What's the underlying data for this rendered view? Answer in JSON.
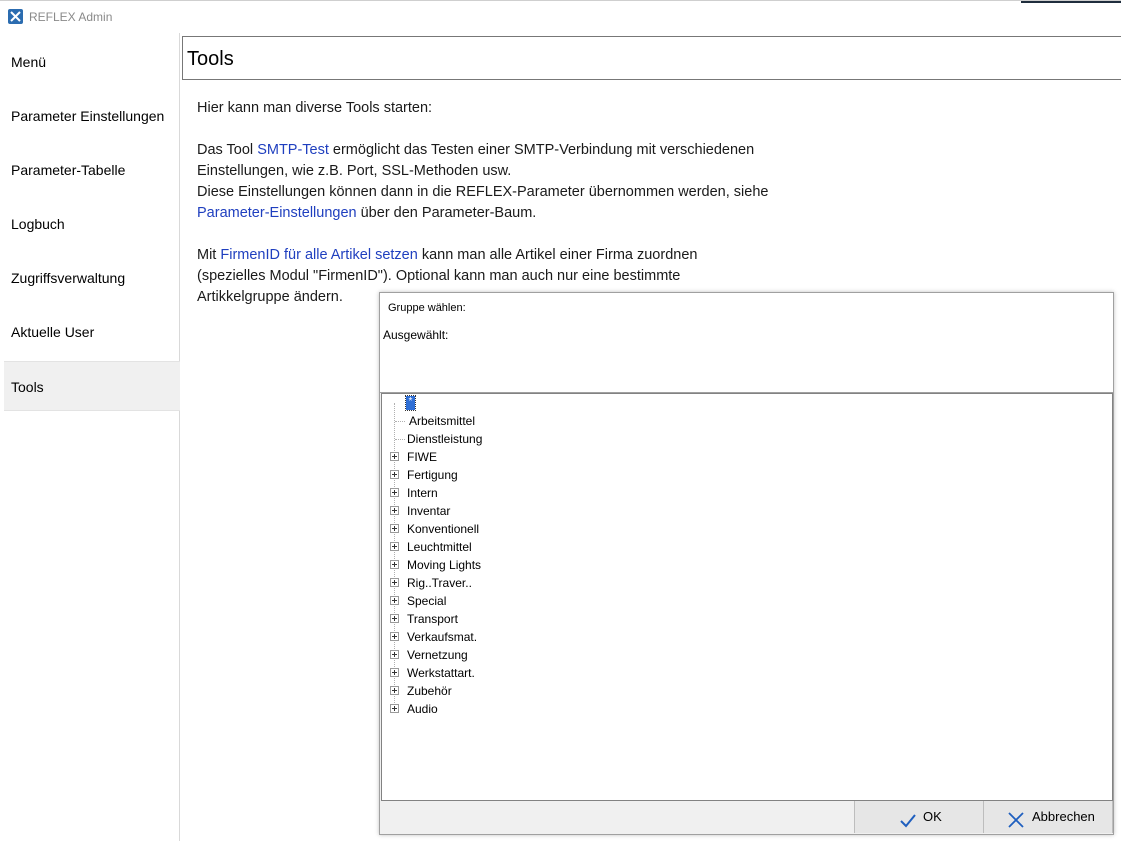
{
  "window": {
    "title": "REFLEX Admin",
    "icon": "tools-icon"
  },
  "sidebar": {
    "items": [
      {
        "label": "Menü"
      },
      {
        "label": "Parameter Einstellungen"
      },
      {
        "label": "Parameter-Tabelle"
      },
      {
        "label": "Logbuch"
      },
      {
        "label": "Zugriffsverwaltung"
      },
      {
        "label": "Aktuelle User"
      },
      {
        "label": "Tools",
        "active": true
      }
    ]
  },
  "main": {
    "title": "Tools",
    "intro": "Hier kann man diverse Tools starten:",
    "p1": {
      "prefix": "Das Tool ",
      "link": "SMTP-Test",
      "line1_rest": " ermöglicht das Testen einer SMTP-Verbindung mit verschiedenen",
      "line2": "Einstellungen, wie z.B. Port, SSL-Methoden usw.",
      "line3": "Diese Einstellungen können dann in die REFLEX-Parameter übernommen werden, siehe",
      "link2": "Parameter-Einstellungen",
      "line4_rest": " über den Parameter-Baum."
    },
    "p2": {
      "prefix": "Mit ",
      "link": "FirmenID für alle Artikel setzen",
      "line1_rest": " kann man alle Artikel einer Firma zuordnen",
      "line2": "(spezielles Modul \"FirmenID\"). Optional kann man auch nur eine bestimmte",
      "line3": "Artikkelgruppe ändern."
    }
  },
  "dialog": {
    "title": "Gruppe wählen:",
    "selected_label": "Ausgewählt:",
    "tree": {
      "root": "*",
      "items": [
        {
          "label": "Arbeitsmittel",
          "expandable": false
        },
        {
          "label": "Dienstleistung",
          "expandable": false
        },
        {
          "label": "FIWE",
          "expandable": true
        },
        {
          "label": "Fertigung",
          "expandable": true
        },
        {
          "label": "Intern",
          "expandable": true
        },
        {
          "label": "Inventar",
          "expandable": true
        },
        {
          "label": "Konventionell",
          "expandable": true
        },
        {
          "label": "Leuchtmittel",
          "expandable": true
        },
        {
          "label": "Moving Lights",
          "expandable": true
        },
        {
          "label": "Rig..Traver..",
          "expandable": true
        },
        {
          "label": "Special",
          "expandable": true
        },
        {
          "label": "Transport",
          "expandable": true
        },
        {
          "label": "Verkaufsmat.",
          "expandable": true
        },
        {
          "label": "Vernetzung",
          "expandable": true
        },
        {
          "label": "Werkstattart.",
          "expandable": true
        },
        {
          "label": "Zubehör",
          "expandable": true
        },
        {
          "label": "Audio",
          "expandable": true
        }
      ]
    },
    "buttons": {
      "ok": "OK",
      "cancel": "Abbrechen"
    },
    "colors": {
      "accent": "#2f6fd6",
      "link": "#1f3fbf",
      "ok_check": "#1f5fbf"
    }
  }
}
